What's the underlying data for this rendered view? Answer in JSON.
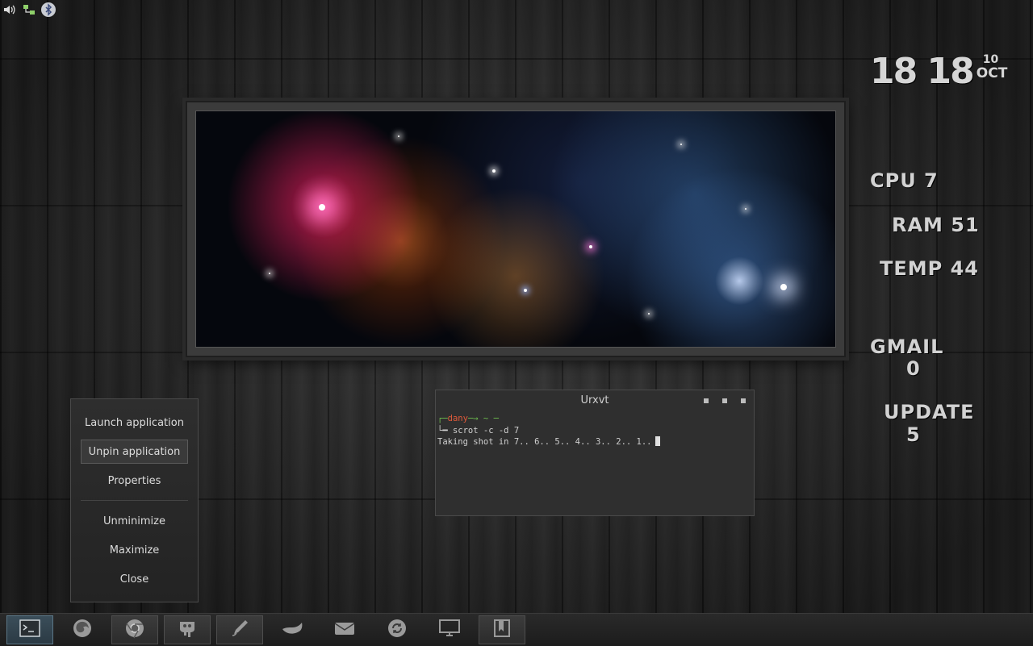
{
  "tray": {
    "icons": [
      "volume-icon",
      "network-icon",
      "bluetooth-icon"
    ]
  },
  "clock": {
    "time": "18 18",
    "day": "10",
    "month": "OCT"
  },
  "stats": {
    "cpu": "CPU 7",
    "ram": "RAM 51",
    "temp": "TEMP 44",
    "gmail_label": "GMAIL",
    "gmail_value": "0",
    "update_label": "UPDATE",
    "update_value": "5"
  },
  "context_menu": {
    "items": [
      {
        "label": "Launch application",
        "active": false
      },
      {
        "label": "Unpin application",
        "active": true
      },
      {
        "label": "Properties",
        "active": false
      },
      {
        "label": "Unminimize",
        "active": false
      },
      {
        "label": "Maximize",
        "active": false
      },
      {
        "label": "Close",
        "active": false
      }
    ]
  },
  "terminal": {
    "title": "Urxvt",
    "prompt_user": "dany",
    "prompt_path": "~",
    "command": "scrot -c -d 7",
    "output": "Taking shot in 7.. 6.. 5.. 4.. 3.. 2.. 1.."
  },
  "taskbar": {
    "items": [
      {
        "name": "terminal",
        "icon": "terminal-icon",
        "state": "active"
      },
      {
        "name": "firefox",
        "icon": "firefox-icon",
        "state": "plain"
      },
      {
        "name": "chrome",
        "icon": "chrome-icon",
        "state": "boxed"
      },
      {
        "name": "gimp",
        "icon": "gimp-icon",
        "state": "boxed"
      },
      {
        "name": "inkscape",
        "icon": "pen-icon",
        "state": "boxed"
      },
      {
        "name": "thunderbird",
        "icon": "bird-icon",
        "state": "plain"
      },
      {
        "name": "mail",
        "icon": "mail-icon",
        "state": "plain"
      },
      {
        "name": "update-manager",
        "icon": "update-icon",
        "state": "plain"
      },
      {
        "name": "display",
        "icon": "monitor-icon",
        "state": "plain"
      },
      {
        "name": "reader",
        "icon": "book-icon",
        "state": "boxed"
      }
    ]
  }
}
